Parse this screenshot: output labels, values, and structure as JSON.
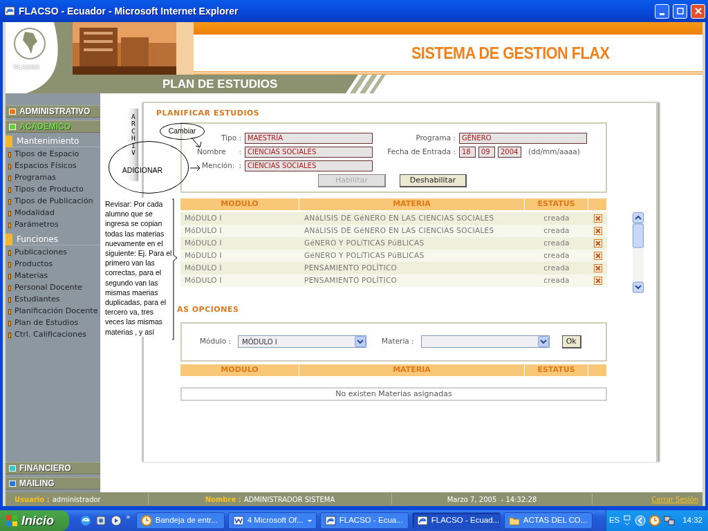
{
  "window": {
    "title": "FLACSO - Ecuador - Microsoft Internet Explorer"
  },
  "header": {
    "logo_text": "FLACSO",
    "system_title": "SISTEMA DE GESTION FLAX",
    "page_title": "PLAN DE ESTUDIOS"
  },
  "sidebar": {
    "sections": [
      {
        "label": "ADMINISTRATIVO",
        "color": "#f07818",
        "selected": false
      },
      {
        "label": "ACADEMICO",
        "color": "#60d030",
        "selected": true
      }
    ],
    "groups": [
      {
        "label": "Mantenimiento",
        "items": [
          "Tipos de Espacio",
          "Espacios Físicos",
          "Programas",
          "Tipos de Producto",
          "Tipos de Publicación",
          "Modalidad",
          "Parámetros"
        ]
      },
      {
        "label": "Funciones",
        "items": [
          "Publicaciones",
          "Productos",
          "Materias",
          "Personal Docente",
          "Estudiantes",
          "Planificación Docente",
          "Plan de Estudios",
          "Ctrl. Calificaciones"
        ]
      }
    ],
    "bottom_sections": [
      {
        "label": "FINANCIERO",
        "color": "#30c8c8",
        "selected": false
      },
      {
        "label": "MAILING",
        "color": "#2878e0",
        "selected": false
      }
    ]
  },
  "plan": {
    "title": "PLANIFICAR ESTUDIOS",
    "tipo": {
      "label": "Tipo :",
      "value": "MAESTRÍA"
    },
    "programa": {
      "label": "Programa :",
      "value": "GÉNERO"
    },
    "nombre": {
      "label": "Nombre",
      "sep": ":",
      "value": "CIENCIAS SOCIALES"
    },
    "fecha": {
      "label": "Fecha de Entrada :",
      "parts": [
        "18",
        "09",
        "2004"
      ],
      "hint": "(dd/mm/aaaa)"
    },
    "mencion": {
      "label": "Mención:",
      "sep": ":",
      "value": "CIENCIAS SOCIALES"
    },
    "buttons": [
      {
        "label": "Habilitar",
        "disabled": true
      },
      {
        "label": "Deshabilitar",
        "disabled": false
      }
    ]
  },
  "table": {
    "columns": [
      "MODULO",
      "MATERIA",
      "ESTATUS"
    ],
    "rows": [
      {
        "module": "MóDULO I",
        "subject": "ANáLISIS DE GéNERO EN LAS CIENCIAS SOCIALES",
        "status": "creada"
      },
      {
        "module": "MóDULO I",
        "subject": "ANáLISIS DE GéNERO EN LAS CIENCIAS SOCIALES",
        "status": "creada"
      },
      {
        "module": "MóDULO I",
        "subject": "GéNERO Y POLíTICAS PúBLICAS",
        "status": "creada"
      },
      {
        "module": "MóDULO I",
        "subject": "GéNERO Y POLíTICAS PúBLICAS",
        "status": "creada"
      },
      {
        "module": "MóDULO I",
        "subject": "PENSAMIENTO POLÍTICO",
        "status": "creada"
      },
      {
        "module": "MóDULO I",
        "subject": "PENSAMIENTO POLÍTICO",
        "status": "creada"
      }
    ]
  },
  "options": {
    "title": "AS OPCIONES",
    "module_label": "Módulo :",
    "module_value": "MÓDULO I",
    "subject_label": "Materia :",
    "ok": "Ok",
    "columns": [
      "MODULO",
      "MATERIA",
      "ESTATUS"
    ],
    "empty": "No existen Materias asignadas"
  },
  "annotations": {
    "side_tab": "ARCHIV",
    "callouts": [
      {
        "kind": "ellipse",
        "text": "Cambiar"
      },
      {
        "kind": "ellipse",
        "text": "ADICIONAR"
      },
      {
        "kind": "note",
        "text": "Revisar: Por cada alumno que se ingresa se copian todas las materias nuevamente en el siguiente: Ej. Para el primero van las correctas, para el segundo van las mismas maerias duplicadas, para el tercero va, tres veces las mismas materias , y así"
      }
    ]
  },
  "status_bar": {
    "user_label": "Usuario :",
    "user": "administrador",
    "name_label": "Nombre :",
    "name": "ADMINISTRADOR SISTEMA",
    "datetime": "Marzo 7, 2005  - 14:32:28",
    "logout": "Cerrar Sesión"
  },
  "taskbar": {
    "start": "Inicio",
    "more": "»",
    "tasks": [
      {
        "label": "Bandeja de entr...",
        "kind": "mail",
        "grouped": false,
        "selected": false
      },
      {
        "label": "4 Microsoft Of...",
        "kind": "word",
        "grouped": true,
        "selected": false
      },
      {
        "label": "FLACSO - Ecua...",
        "kind": "browser",
        "grouped": false,
        "selected": false
      },
      {
        "label": "FLACSO - Ecuad...",
        "kind": "browser",
        "grouped": false,
        "selected": true
      },
      {
        "label": "ACTAS DEL CO...",
        "kind": "folder",
        "grouped": false,
        "selected": false
      }
    ],
    "language": "ES",
    "clock": "14:32"
  }
}
